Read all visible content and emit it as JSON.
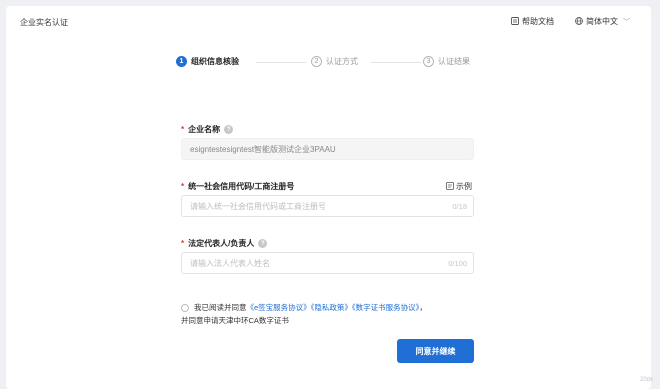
{
  "header": {
    "title": "企业实名认证",
    "help_label": "帮助文档",
    "lang_label": "简体中文"
  },
  "steps": [
    {
      "num": "1",
      "label": "组织信息核验",
      "active": true
    },
    {
      "num": "2",
      "label": "认证方式",
      "active": false
    },
    {
      "num": "3",
      "label": "认证结果",
      "active": false
    }
  ],
  "form": {
    "company_name": {
      "label": "企业名称",
      "value": "esigntestesigntest智能版测试企业3PAAU"
    },
    "credit_code": {
      "label": "统一社会信用代码/工商注册号",
      "placeholder": "请输入统一社会信用代码或工商注册号",
      "counter": "0/18",
      "example_label": "示例"
    },
    "legal_rep": {
      "label": "法定代表人/负责人",
      "placeholder": "请输入法人代表人姓名",
      "counter": "0/100"
    }
  },
  "agreement": {
    "prefix": "我已阅读并同意",
    "link1": "《e签宝服务协议》",
    "link2": "《隐私政策》",
    "link3": "《数字证书服务协议》",
    "suffix": "，",
    "line2": "并同意申请天津中环CA数字证书"
  },
  "submit_label": "同意并继续",
  "watermark": "20dx",
  "colors": {
    "accent": "#1f6fd6",
    "required": "#e53935"
  }
}
